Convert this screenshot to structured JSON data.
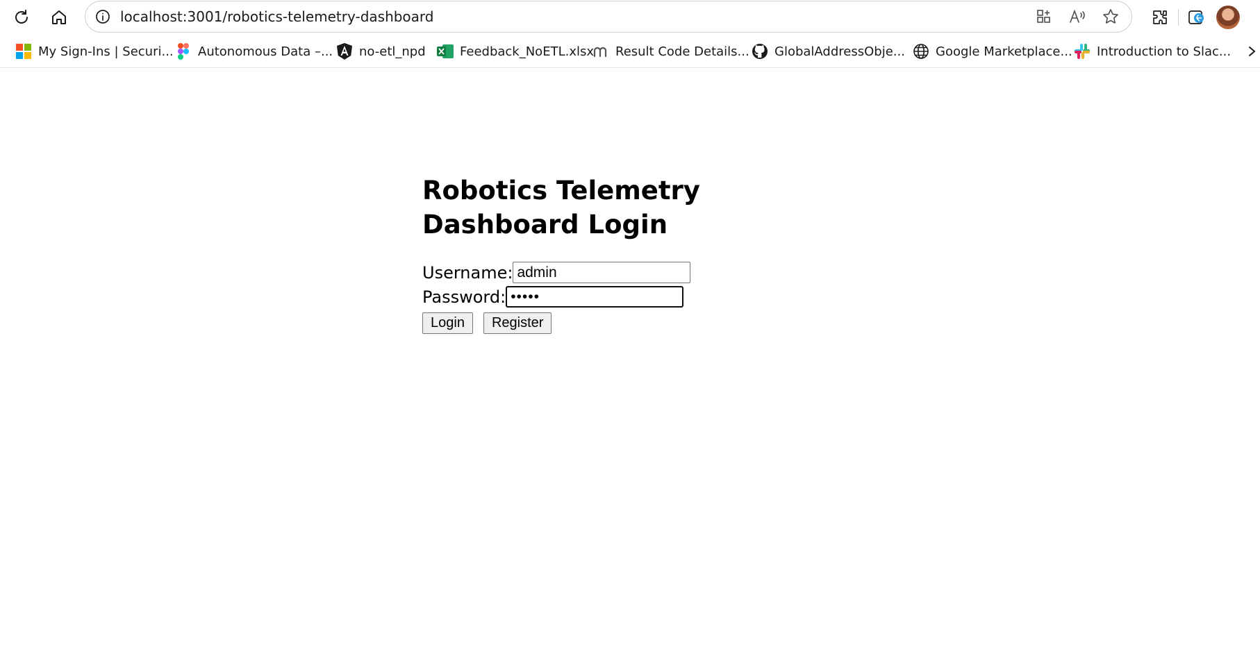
{
  "browser": {
    "url": "localhost:3001/robotics-telemetry-dashboard",
    "toolbar_icons": [
      "reload-icon",
      "home-icon",
      "site-info-icon",
      "app-available-icon",
      "read-aloud-icon",
      "favorite-star-icon",
      "extensions-icon",
      "edge-collections-icon"
    ],
    "bookmarks": [
      {
        "label": "My Sign-Ins | Securi...",
        "icon": "microsoft-logo-icon"
      },
      {
        "label": "Autonomous Data –...",
        "icon": "figma-logo-icon"
      },
      {
        "label": "no-etl_npd",
        "icon": "angular-logo-icon"
      },
      {
        "label": "Feedback_NoETL.xlsx",
        "icon": "excel-logo-icon"
      },
      {
        "label": "Result Code Details...",
        "icon": "m-logo-icon"
      },
      {
        "label": "GlobalAddressObje...",
        "icon": "github-logo-icon"
      },
      {
        "label": "Google Marketplace...",
        "icon": "globe-icon"
      },
      {
        "label": "Introduction to Slac...",
        "icon": "slack-logo-icon"
      }
    ]
  },
  "page": {
    "title": "Robotics Telemetry Dashboard Login",
    "username_label": "Username:",
    "username_value": "admin",
    "password_label": "Password:",
    "password_value": "•••••",
    "login_button": "Login",
    "register_button": "Register"
  }
}
